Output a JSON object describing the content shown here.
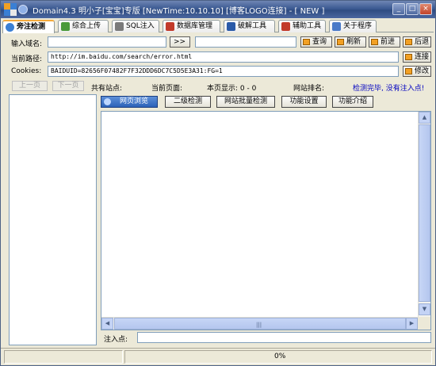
{
  "window": {
    "title": "Domain4.3 明小子[宝宝]专版 [NewTime:10.10.10] [博客LOGO连接]  - [ NEW ]",
    "controls": [
      "_",
      "□",
      "×"
    ]
  },
  "tabs": [
    {
      "label": "旁注检测",
      "active": true
    },
    {
      "label": "综合上传"
    },
    {
      "label": "SQL注入"
    },
    {
      "label": "数据库管理"
    },
    {
      "label": "破解工具"
    },
    {
      "label": "辅助工具"
    },
    {
      "label": "关于程序"
    }
  ],
  "form": {
    "domain_label": "输入域名:",
    "domain_value": "",
    "go_label": ">>",
    "domain2_value": "",
    "query_label": "查询",
    "refresh_label": "刷新",
    "forward_label": "前进",
    "back_label": "后退",
    "path_label": "当前路径:",
    "path_value": "http://im.baidu.com/search/error.html",
    "connect_label": "连接",
    "cookies_label": "Cookies:",
    "cookies_value": "BAIDUID=82656F07482F7F32DDD6DC7C5D5E3A31:FG=1",
    "modify_label": "修改"
  },
  "info": {
    "prev_page": "上一页",
    "next_page": "下一页",
    "total_sites": "共有站点:",
    "current_page": "当前页面:",
    "page_display": "本页显示: 0 - 0",
    "site_rank": "网站排名:",
    "status_msg": "检测完毕, 没有注入点!"
  },
  "functions": {
    "web_browse": "网页浏览",
    "secondary_detect": "二级检测",
    "batch_detect": "网站批量检测",
    "settings": "功能设置",
    "intro": "功能介绍"
  },
  "injection": {
    "label": "注入点:",
    "value": ""
  },
  "statusbar": {
    "progress": "0%"
  },
  "colors": {
    "status_msg": "#0000c0",
    "title_bg": "#3c5a92",
    "tab_accent": "#f3a93c"
  }
}
